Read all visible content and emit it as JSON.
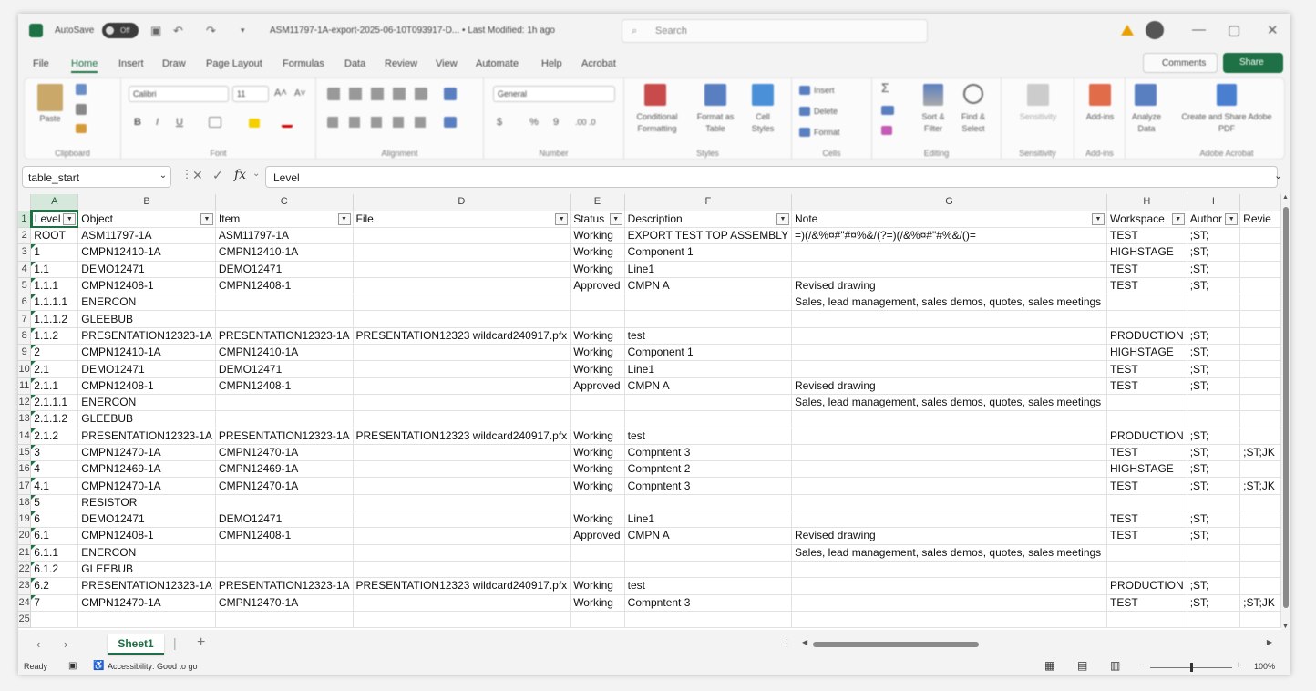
{
  "titlebar": {
    "autosave": "AutoSave",
    "toggle": "Off",
    "doc_title": "ASM11797-1A-export-2025-06-10T093917-D... • Last Modified: 1h ago",
    "search_placeholder": "Search"
  },
  "menu": [
    "File",
    "Home",
    "Insert",
    "Draw",
    "Page Layout",
    "Formulas",
    "Data",
    "Review",
    "View",
    "Automate",
    "Help",
    "Acrobat"
  ],
  "comments_label": "Comments",
  "share_label": "Share",
  "ribbon": {
    "groups": [
      "Clipboard",
      "Font",
      "Alignment",
      "Number",
      "Styles",
      "Cells",
      "Editing",
      "Sensitivity",
      "Add-ins",
      "Adobe Acrobat"
    ],
    "paste": "Paste",
    "font_name": "Calibri",
    "font_size": "11",
    "number_format": "General",
    "conditional": "Conditional Formatting",
    "format_table": "Format as Table",
    "cell_styles": "Cell Styles",
    "insert": "Insert",
    "delete": "Delete",
    "format": "Format",
    "sort_filter": "Sort & Filter",
    "find_select": "Find & Select",
    "sensitivity": "Sensitivity",
    "addins": "Add-ins",
    "analyze": "Analyze Data",
    "create_pdf": "Create and Share Adobe PDF"
  },
  "formula_bar": {
    "name_box": "table_start",
    "fx": "fx",
    "content": "Level"
  },
  "columns": [
    "A",
    "B",
    "C",
    "D",
    "E",
    "F",
    "G",
    "H",
    "I"
  ],
  "headers": [
    "Level",
    "Object",
    "Item",
    "File",
    "Status",
    "Description",
    "Note",
    "Workspace",
    "Author",
    "Revie"
  ],
  "rows": [
    [
      "ROOT",
      "ASM11797-1A",
      "ASM11797-1A",
      "",
      "Working",
      "EXPORT TEST TOP ASSEMBLY",
      "=)(/&%¤#\"#¤%&/(?=)(/&%¤#\"#%&/()=",
      "TEST",
      ";ST;",
      ""
    ],
    [
      "1",
      "CMPN12410-1A",
      "CMPN12410-1A",
      "",
      "Working",
      "Component 1",
      "",
      "HIGHSTAGE",
      ";ST;",
      ""
    ],
    [
      "1.1",
      "DEMO12471",
      "DEMO12471",
      "",
      "Working",
      "Line1",
      "",
      "TEST",
      ";ST;",
      ""
    ],
    [
      "1.1.1",
      "CMPN12408-1",
      "CMPN12408-1",
      "",
      "Approved",
      "CMPN A",
      "Revised drawing",
      "TEST",
      ";ST;",
      ""
    ],
    [
      "1.1.1.1",
      "ENERCON",
      "",
      "",
      "",
      "",
      "Sales, lead management, sales demos, quotes, sales meetings",
      "",
      "",
      ""
    ],
    [
      "1.1.1.2",
      "GLEEBUB",
      "",
      "",
      "",
      "",
      "",
      "",
      "",
      ""
    ],
    [
      "1.1.2",
      "PRESENTATION12323-1A",
      "PRESENTATION12323-1A",
      "PRESENTATION12323 wildcard240917.pfx",
      "Working",
      "test",
      "",
      "PRODUCTION",
      ";ST;",
      ""
    ],
    [
      "2",
      "CMPN12410-1A",
      "CMPN12410-1A",
      "",
      "Working",
      "Component 1",
      "",
      "HIGHSTAGE",
      ";ST;",
      ""
    ],
    [
      "2.1",
      "DEMO12471",
      "DEMO12471",
      "",
      "Working",
      "Line1",
      "",
      "TEST",
      ";ST;",
      ""
    ],
    [
      "2.1.1",
      "CMPN12408-1",
      "CMPN12408-1",
      "",
      "Approved",
      "CMPN A",
      "Revised drawing",
      "TEST",
      ";ST;",
      ""
    ],
    [
      "2.1.1.1",
      "ENERCON",
      "",
      "",
      "",
      "",
      "Sales, lead management, sales demos, quotes, sales meetings",
      "",
      "",
      ""
    ],
    [
      "2.1.1.2",
      "GLEEBUB",
      "",
      "",
      "",
      "",
      "",
      "",
      "",
      ""
    ],
    [
      "2.1.2",
      "PRESENTATION12323-1A",
      "PRESENTATION12323-1A",
      "PRESENTATION12323 wildcard240917.pfx",
      "Working",
      "test",
      "",
      "PRODUCTION",
      ";ST;",
      ""
    ],
    [
      "3",
      "CMPN12470-1A",
      "CMPN12470-1A",
      "",
      "Working",
      "Compntent 3",
      "",
      "TEST",
      ";ST;",
      ";ST;JK"
    ],
    [
      "4",
      "CMPN12469-1A",
      "CMPN12469-1A",
      "",
      "Working",
      "Compntent 2",
      "",
      "HIGHSTAGE",
      ";ST;",
      ""
    ],
    [
      "4.1",
      "CMPN12470-1A",
      "CMPN12470-1A",
      "",
      "Working",
      "Compntent 3",
      "",
      "TEST",
      ";ST;",
      ";ST;JK"
    ],
    [
      "5",
      "RESISTOR",
      "",
      "",
      "",
      "",
      "",
      "",
      "",
      ""
    ],
    [
      "6",
      "DEMO12471",
      "DEMO12471",
      "",
      "Working",
      "Line1",
      "",
      "TEST",
      ";ST;",
      ""
    ],
    [
      "6.1",
      "CMPN12408-1",
      "CMPN12408-1",
      "",
      "Approved",
      "CMPN A",
      "Revised drawing",
      "TEST",
      ";ST;",
      ""
    ],
    [
      "6.1.1",
      "ENERCON",
      "",
      "",
      "",
      "",
      "Sales, lead management, sales demos, quotes, sales meetings",
      "",
      "",
      ""
    ],
    [
      "6.1.2",
      "GLEEBUB",
      "",
      "",
      "",
      "",
      "",
      "",
      "",
      ""
    ],
    [
      "6.2",
      "PRESENTATION12323-1A",
      "PRESENTATION12323-1A",
      "PRESENTATION12323 wildcard240917.pfx",
      "Working",
      "test",
      "",
      "PRODUCTION",
      ";ST;",
      ""
    ],
    [
      "7",
      "CMPN12470-1A",
      "CMPN12470-1A",
      "",
      "Working",
      "Compntent 3",
      "",
      "TEST",
      ";ST;",
      ";ST;JK"
    ],
    [
      "",
      "",
      "",
      "",
      "",
      "",
      "",
      "",
      "",
      ""
    ]
  ],
  "sheet_tab": "Sheet1",
  "status": {
    "ready": "Ready",
    "accessibility": "Accessibility: Good to go",
    "zoom": "100%"
  },
  "colors": {
    "accent": "#1e7145"
  }
}
